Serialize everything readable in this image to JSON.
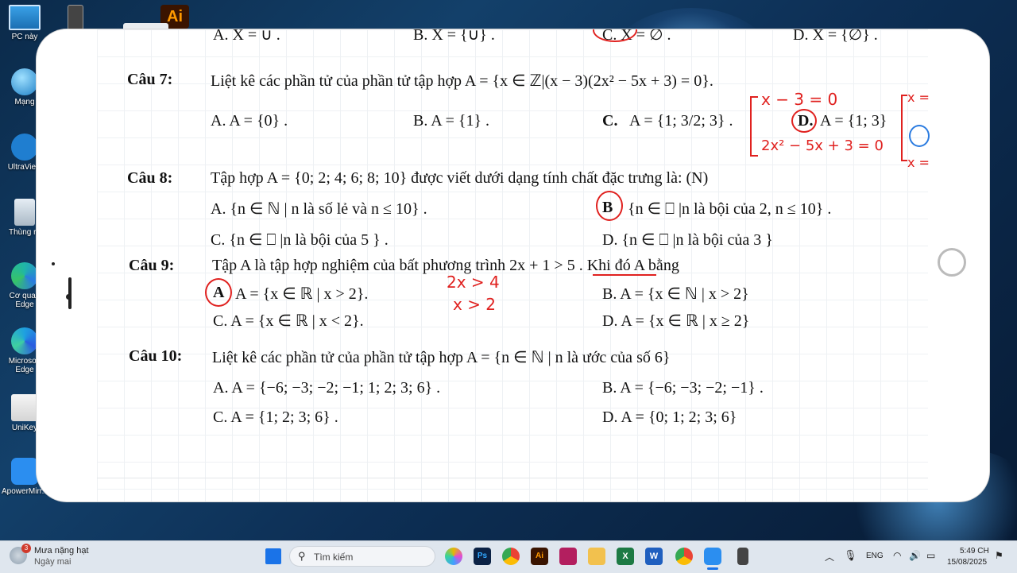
{
  "desktop": {
    "icons": [
      {
        "label": "PC này"
      },
      {
        "label": "Mạng"
      },
      {
        "label": "UltraView"
      },
      {
        "label": "Thùng rá"
      },
      {
        "label": "Cơ quan Edge"
      },
      {
        "label": "Microsoft Edge"
      },
      {
        "label": "UniKey"
      },
      {
        "label": "ApowerMirr..."
      }
    ],
    "ai_icon_label": "Ai"
  },
  "doc": {
    "top_row": {
      "a": "A. X = ∪ .",
      "b": "B. X = {∪} .",
      "c": "C. X = ∅ .",
      "d": "D. X = {∅} ."
    },
    "q7": {
      "label": "Câu 7:",
      "text": "Liệt kê các phần tử của phần tử tập hợp A = {x ∈ ℤ|(x − 3)(2x² − 5x + 3) = 0}.",
      "a": "A.  A = {0} .",
      "b": "B.  A = {1} .",
      "c_label": "C.",
      "c": "A = {1; 3/2; 3} .",
      "d_label": "D.",
      "d": "A = {1; 3}"
    },
    "q8": {
      "label": "Câu 8:",
      "text": "Tập hợp  A = {0; 2; 4; 6; 8; 10}  được viết dưới dạng tính chất đặc trưng là: (N)",
      "a": "A. {n ∈ ℕ | n là số lẻ và  n ≤ 10} .",
      "b_label": "B",
      "b": "{n ∈ ⎕ |n  là bội của  2, n ≤ 10} .",
      "c": "C. {n ∈ ⎕ |n  là bội của 5 } .",
      "d": "D. {n ∈ ⎕ |n  là bội của 3 }"
    },
    "q9": {
      "label": "Câu 9:",
      "text": "Tập  A là tập hợp nghiệm của bất phương trình  2x + 1 > 5 . Khi đó  A  bằng",
      "a_label": "A",
      "a": "A = {x ∈ ℝ | x > 2}.",
      "b": "B. A = {x ∈ ℕ | x > 2}",
      "c": "C. A = {x ∈ ℝ | x < 2}.",
      "d": "D. A = {x ∈ ℝ | x ≥ 2}"
    },
    "q10": {
      "label": "Câu 10:",
      "text": "Liệt kê các phần tử của phần tử tập hợp A = {n ∈ ℕ | n là ước của số  6}",
      "a": "A.   A = {−6; −3; −2; −1; 1; 2; 3; 6} .",
      "b": "B.   A = {−6; −3; −2; −1} .",
      "c": "C.   A = {1; 2; 3; 6} .",
      "d": "D.   A = {0; 1; 2; 3; 6}"
    },
    "handwriting": {
      "h1": "x − 3 = 0",
      "h2": "2x² − 5x + 3 = 0",
      "h3": "2x > 4",
      "h4": "x > 2",
      "h5": "x =",
      "h6": "x ="
    }
  },
  "taskbar": {
    "weather_title": "Mưa nặng hạt",
    "weather_sub": "Ngày mai",
    "weather_badge": "3",
    "search_placeholder": "Tìm kiếm",
    "lang": "ENG",
    "time": "5:49 CH",
    "date": "15/08/2025"
  },
  "colors": {
    "accent_red": "#e0211f",
    "taskbar_bg": "#dfe6ee"
  }
}
